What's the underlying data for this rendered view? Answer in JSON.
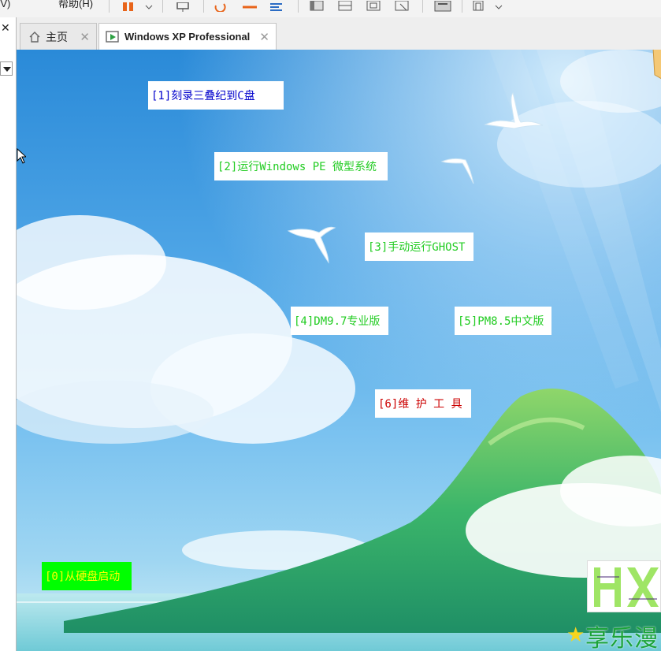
{
  "toolbar": {
    "menu_left": "查看(V)",
    "menu_help": "帮助(H)"
  },
  "tabs": [
    {
      "label": "主页",
      "icon": "home-icon",
      "active": false
    },
    {
      "label": "Windows XP Professional",
      "icon": "vm-icon",
      "active": true
    }
  ],
  "boot_menu": {
    "items": [
      {
        "label": "[1]刻录三叠纪到C盘",
        "color": "#0000cc"
      },
      {
        "label": "[2]运行Windows PE 微型系统",
        "color": "#22cc22"
      },
      {
        "label": "[3]手动运行GHOST",
        "color": "#22cc22"
      },
      {
        "label": "[4]DM9.7专业版",
        "color": "#22cc22"
      },
      {
        "label": "[5]PM8.5中文版",
        "color": "#22cc22"
      },
      {
        "label": "[6]维 护 工 具",
        "color": "#cc0000"
      },
      {
        "label": "[0]从硬盘启动",
        "color": "#ffff00",
        "background": "#00ff00"
      }
    ]
  },
  "logo": {
    "text": "享乐漫",
    "accent": "#1ba33a"
  }
}
